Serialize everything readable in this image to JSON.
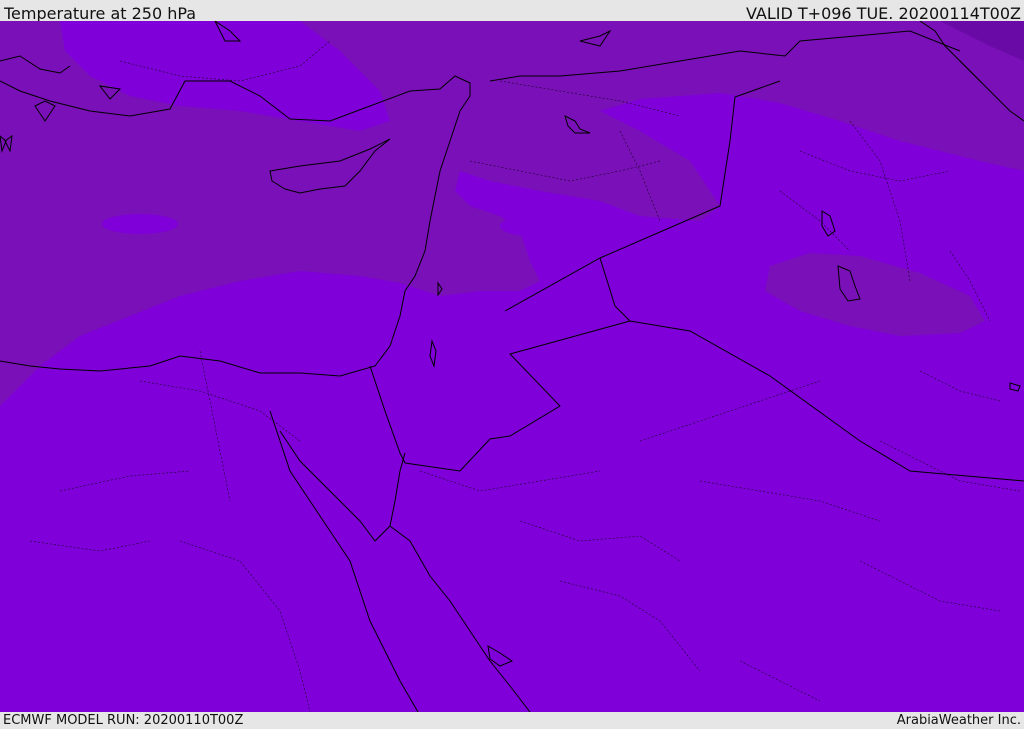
{
  "header": {
    "title": "Temperature at 250 hPa",
    "valid": "VALID T+096 TUE. 20200114T00Z"
  },
  "footer": {
    "model_run": "ECMWF MODEL RUN: 20200110T00Z",
    "credit": "ArabiaWeather Inc."
  },
  "colors": {
    "field_warm": "#7f00d9",
    "field_cold": "#7a10b8",
    "field_coldest": "#6a0aa6",
    "coastline": "#000000",
    "bars": "#e6e6e6"
  }
}
